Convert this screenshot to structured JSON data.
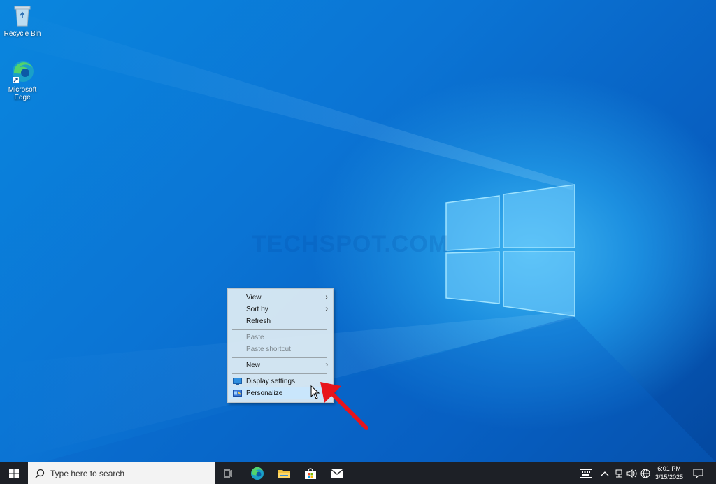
{
  "desktop": {
    "icons": [
      {
        "label": "Recycle Bin",
        "icon": "recycle-bin-icon"
      },
      {
        "label": "Microsoft Edge",
        "icon": "edge-icon"
      }
    ],
    "watermark": "TECHSPOT.COM"
  },
  "context_menu": {
    "items": [
      {
        "label": "View",
        "submenu": true,
        "enabled": true
      },
      {
        "label": "Sort by",
        "submenu": true,
        "enabled": true
      },
      {
        "label": "Refresh",
        "submenu": false,
        "enabled": true
      },
      {
        "label": "Paste",
        "submenu": false,
        "enabled": false
      },
      {
        "label": "Paste shortcut",
        "submenu": false,
        "enabled": false
      },
      {
        "label": "New",
        "submenu": true,
        "enabled": true
      },
      {
        "label": "Display settings",
        "submenu": false,
        "enabled": true,
        "icon": "display-icon"
      },
      {
        "label": "Personalize",
        "submenu": false,
        "enabled": true,
        "icon": "personalize-icon",
        "hovered": true
      }
    ],
    "chevron": "›"
  },
  "taskbar": {
    "search_placeholder": "Type here to search",
    "pinned": [
      "task-view-icon",
      "edge-icon",
      "file-explorer-icon",
      "store-icon",
      "mail-icon"
    ],
    "tray": [
      "keyboard-icon",
      "chevron-up-icon",
      "network-icon",
      "volume-icon",
      "globe-icon"
    ],
    "time": "6:01 PM",
    "date": "3/15/2025"
  },
  "colors": {
    "taskbar": "#1d2026",
    "accent": "#0b74d4",
    "annotation_arrow": "#e8141c"
  }
}
